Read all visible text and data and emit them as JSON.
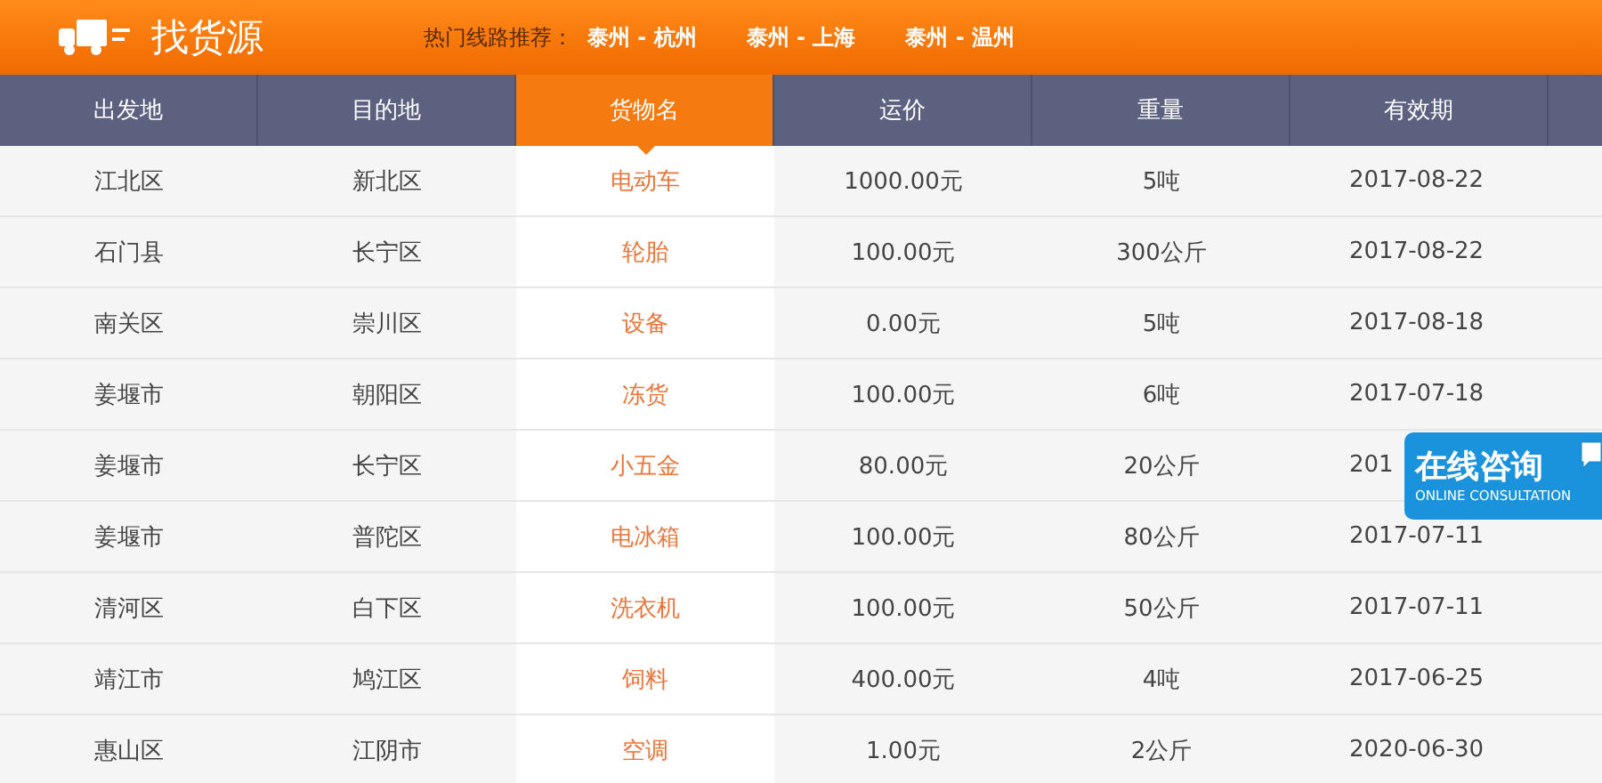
{
  "header": {
    "title": "找货源",
    "hot_routes_label": "热门线路推荐：",
    "hot_routes": [
      "泰州 - 杭州",
      "泰州 - 上海",
      "泰州 - 温州"
    ]
  },
  "table": {
    "columns": [
      {
        "label": "出发地",
        "selected": false
      },
      {
        "label": "目的地",
        "selected": false
      },
      {
        "label": "货物名",
        "selected": true
      },
      {
        "label": "运价",
        "selected": false
      },
      {
        "label": "重量",
        "selected": false
      },
      {
        "label": "有效期",
        "selected": false
      }
    ],
    "rows": [
      [
        "江北区",
        "新北区",
        "电动车",
        "1000.00元",
        "5吨",
        "2017-08-22"
      ],
      [
        "石门县",
        "长宁区",
        "轮胎",
        "100.00元",
        "300公斤",
        "2017-08-22"
      ],
      [
        "南关区",
        "崇川区",
        "设备",
        "0.00元",
        "5吨",
        "2017-08-18"
      ],
      [
        "姜堰市",
        "朝阳区",
        "冻货",
        "100.00元",
        "6吨",
        "2017-07-18"
      ],
      [
        "姜堰市",
        "长宁区",
        "小五金",
        "80.00元",
        "20公斤",
        "201"
      ],
      [
        "姜堰市",
        "普陀区",
        "电冰箱",
        "100.00元",
        "80公斤",
        "2017-07-11"
      ],
      [
        "清河区",
        "白下区",
        "洗衣机",
        "100.00元",
        "50公斤",
        "2017-07-11"
      ],
      [
        "靖江市",
        "鸠江区",
        "饲料",
        "400.00元",
        "4吨",
        "2017-06-25"
      ],
      [
        "惠山区",
        "江阴市",
        "空调",
        "1.00元",
        "2公斤",
        "2020-06-30"
      ]
    ]
  },
  "consult_button": {
    "title": "在线咨询",
    "subtitle": "ONLINE CONSULTATION"
  }
}
